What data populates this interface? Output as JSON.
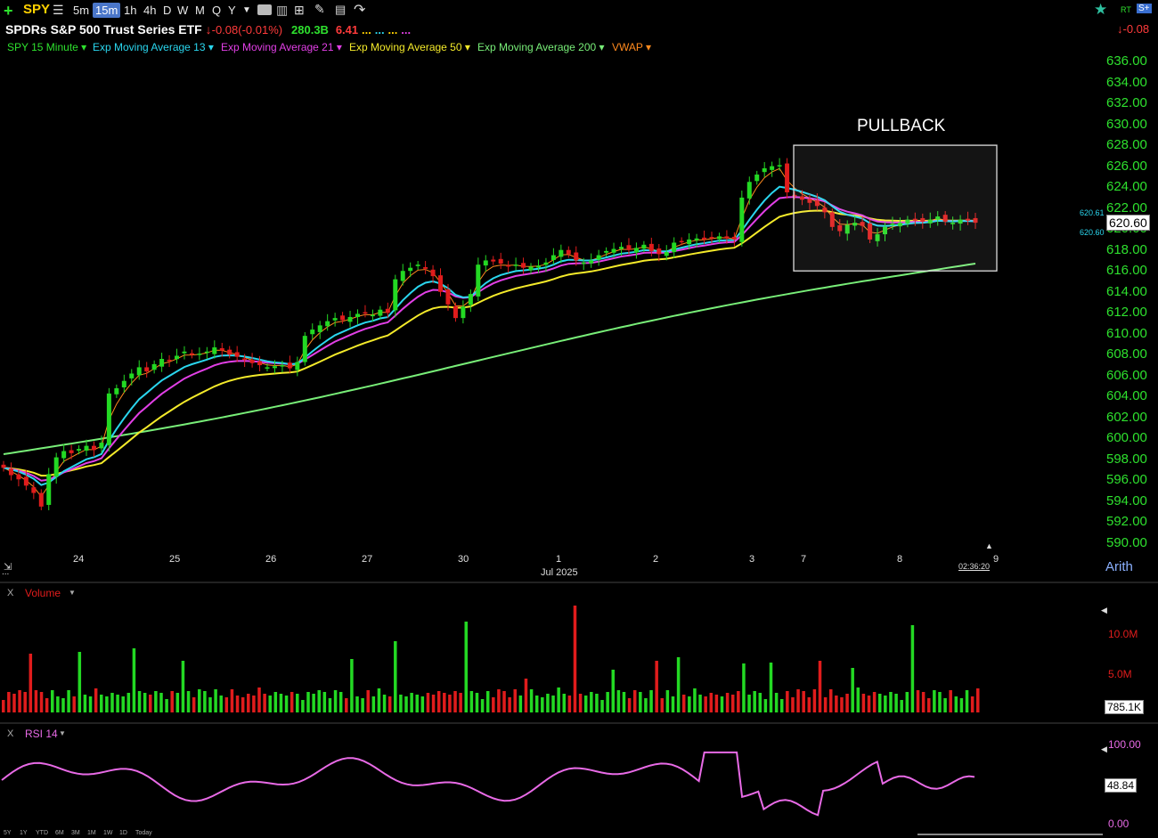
{
  "toolbar": {
    "ticker": "SPY",
    "timeframes": [
      "5m",
      "15m",
      "1h",
      "4h",
      "D",
      "W",
      "M",
      "Q",
      "Y"
    ],
    "selected_timeframe": "15m",
    "right_badges": [
      "RT",
      "S+"
    ]
  },
  "header": {
    "name": "SPDRs S&P 500 Trust Series ETF",
    "change": "-0.08",
    "change_pct": "(-0.01%)",
    "market_cap": "280.3B",
    "value2": "6.41",
    "dots": "...",
    "right_change": "-0.08"
  },
  "indicators": [
    {
      "label": "SPY 15 Minute",
      "color": "#2ee02e"
    },
    {
      "label": "Exp Moving Average 13",
      "color": "#2ad6ee"
    },
    {
      "label": "Exp Moving Average 21",
      "color": "#e23fe6"
    },
    {
      "label": "Exp Moving Average 50",
      "color": "#f4ea2a"
    },
    {
      "label": "Exp Moving Average 200",
      "color": "#78ee78"
    },
    {
      "label": "VWAP",
      "color": "#ff8a1e"
    }
  ],
  "annotation": "PULLBACK",
  "price_panel": {
    "last_price": "620.60",
    "ema13_tag": "620.61",
    "ema21_tag": "620.60",
    "scale_mode": "Arith",
    "timer": "02:36:20"
  },
  "volume_panel": {
    "label": "Volume",
    "ticks": [
      "10.0M",
      "5.0M"
    ],
    "last": "785.1K"
  },
  "rsi_panel": {
    "label": "RSI 14",
    "ticks": [
      "100.00",
      "0.00"
    ],
    "last": "48.84"
  },
  "x_axis": {
    "month_label": "Jul 2025",
    "partial_first": "...",
    "last_tick": "9"
  },
  "range_buttons": [
    "5Y",
    "1Y",
    "YTD",
    "6M",
    "3M",
    "1M",
    "1W",
    "1D",
    "Today"
  ],
  "colors": {
    "up": "#23d923",
    "down": "#e01c1c",
    "ema13": "#2ad6ee",
    "ema21": "#e23fe6",
    "ema50": "#f4ea2a",
    "ema200": "#78ee78",
    "vwap": "#ff8a1e",
    "rsi": "#e86ae6"
  },
  "chart_data": {
    "type": "candlestick",
    "ylim": [
      590,
      636
    ],
    "y_ticks": [
      636,
      634,
      632,
      630,
      628,
      626,
      624,
      622,
      620,
      618,
      616,
      614,
      612,
      610,
      608,
      606,
      604,
      602,
      600,
      598,
      596,
      594,
      592,
      590
    ],
    "x_ticks": [
      "24",
      "25",
      "26",
      "27",
      "30",
      "1",
      "2",
      "3",
      "7",
      "8"
    ],
    "closes": [
      597.2,
      596.5,
      596.1,
      595.5,
      594.8,
      593.5,
      596.6,
      598.2,
      598.8,
      598.6,
      599.0,
      599.3,
      598.9,
      599.6,
      604.3,
      604.8,
      605.5,
      606.2,
      606.8,
      606.4,
      607.1,
      607.6,
      607.5,
      607.9,
      608.3,
      608.0,
      608.1,
      608.3,
      608.7,
      608.4,
      608.0,
      607.8,
      607.5,
      607.2,
      607.0,
      606.8,
      606.9,
      607.0,
      606.7,
      607.3,
      609.8,
      610.4,
      610.8,
      611.2,
      611.5,
      611.3,
      611.6,
      611.9,
      612.0,
      611.8,
      612.3,
      612.0,
      615.2,
      616.0,
      616.3,
      616.6,
      616.2,
      615.5,
      614.0,
      612.8,
      611.5,
      612.6,
      613.8,
      616.6,
      617.0,
      616.9,
      616.7,
      616.5,
      616.6,
      616.3,
      616.4,
      616.5,
      616.8,
      617.5,
      618.0,
      617.6,
      617.0,
      616.8,
      617.0,
      617.5,
      617.9,
      618.1,
      618.3,
      618.0,
      618.2,
      618.5,
      617.9,
      617.6,
      617.8,
      618.7,
      618.8,
      619.0,
      619.1,
      619.0,
      619.2,
      619.3,
      619.1,
      619.0,
      623.0,
      624.5,
      625.2,
      625.8,
      626.0,
      626.1,
      623.5,
      623.2,
      622.8,
      622.5,
      622.2,
      621.6,
      620.2,
      619.8,
      620.4,
      620.6,
      620.3,
      619.0,
      619.5,
      620.2,
      620.5,
      620.6,
      620.9,
      620.8,
      620.7,
      620.9,
      621.2,
      620.7,
      620.6,
      620.9,
      620.8,
      620.6
    ],
    "annotation_box": {
      "label": "PULLBACK",
      "price_range": [
        616,
        628
      ]
    }
  }
}
